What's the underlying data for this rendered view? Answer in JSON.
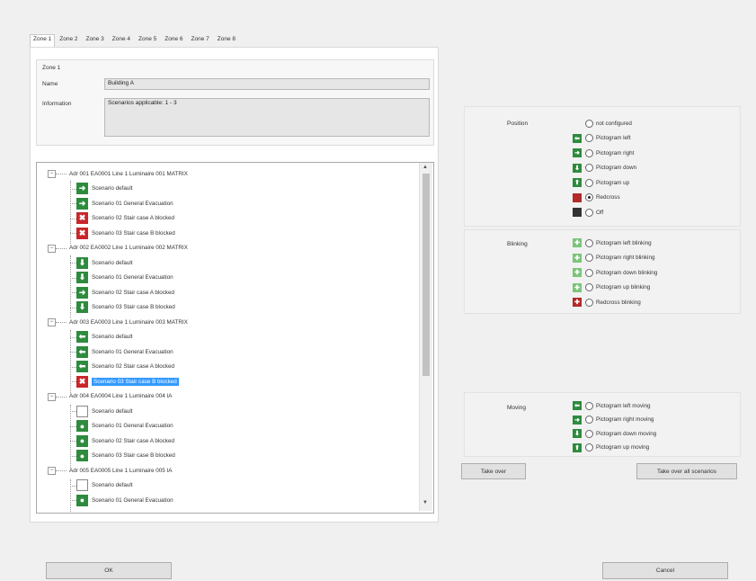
{
  "tabs": [
    "Zone 1",
    "Zone 2",
    "Zone 3",
    "Zone 4",
    "Zone 5",
    "Zone 6",
    "Zone 7",
    "Zone 8"
  ],
  "zone": {
    "title": "Zone 1",
    "name_label": "Name",
    "name_value": "Building A",
    "info_label": "Information",
    "info_value": "Scenarios applicable: 1 - 3"
  },
  "tree": [
    {
      "type": "adr",
      "text": "Adr  001  EA0001  Line 1 Luminaire 001  MATRIX"
    },
    {
      "type": "scn",
      "icon": "g",
      "glyph": "➜",
      "text": "Scenario default"
    },
    {
      "type": "scn",
      "icon": "g",
      "glyph": "➜",
      "text": "Scenario 01   General Evacuation"
    },
    {
      "type": "scn",
      "icon": "r",
      "glyph": "✖",
      "text": "Scenario 02   Stair case A blocked"
    },
    {
      "type": "scn",
      "icon": "r",
      "glyph": "✖",
      "text": "Scenario 03   Stair case B blocked"
    },
    {
      "type": "adr",
      "text": "Adr  002  EA0002  Line 1 Luminaire 002  MATRIX"
    },
    {
      "type": "scn",
      "icon": "g",
      "glyph": "⬇",
      "text": "Scenario default"
    },
    {
      "type": "scn",
      "icon": "g",
      "glyph": "⬇",
      "text": "Scenario 01   General Evacuation"
    },
    {
      "type": "scn",
      "icon": "g",
      "glyph": "➜",
      "text": "Scenario 02   Stair case A blocked"
    },
    {
      "type": "scn",
      "icon": "g",
      "glyph": "⬇",
      "text": "Scenario 03   Stair case B blocked"
    },
    {
      "type": "adr",
      "text": "Adr  003  EA0003  Line 1 Luminaire 003  MATRIX"
    },
    {
      "type": "scn",
      "icon": "g",
      "glyph": "⬅",
      "text": "Scenario default"
    },
    {
      "type": "scn",
      "icon": "g",
      "glyph": "⬅",
      "text": "Scenario 01   General Evacuation"
    },
    {
      "type": "scn",
      "icon": "g",
      "glyph": "⬅",
      "text": "Scenario 02   Stair case A blocked"
    },
    {
      "type": "scn",
      "icon": "r",
      "glyph": "✖",
      "text": "Scenario 03   Stair case B blocked",
      "selected": true
    },
    {
      "type": "adr",
      "text": "Adr  004  EA0004  Line 1 Luminaire 004  IA"
    },
    {
      "type": "scn",
      "icon": "w",
      "glyph": "",
      "text": "Scenario default"
    },
    {
      "type": "scn",
      "icon": "g",
      "glyph": "●",
      "text": "Scenario 01   General Evacuation"
    },
    {
      "type": "scn",
      "icon": "g",
      "glyph": "●",
      "text": "Scenario 02   Stair case A blocked"
    },
    {
      "type": "scn",
      "icon": "g",
      "glyph": "●",
      "text": "Scenario 03   Stair case B blocked"
    },
    {
      "type": "adr",
      "text": "Adr  005  EA0005  Line 1 Luminaire 005  IA"
    },
    {
      "type": "scn",
      "icon": "w",
      "glyph": "",
      "text": "Scenario default"
    },
    {
      "type": "scn",
      "icon": "g",
      "glyph": "●",
      "text": "Scenario 01   General Evacuation"
    }
  ],
  "position": {
    "label": "Position",
    "options": [
      {
        "text": "not configured",
        "swatch": "none",
        "glyph": "",
        "checked": false
      },
      {
        "text": "Pictogram left",
        "swatch": "#2e8b3e",
        "glyph": "⬅",
        "checked": false
      },
      {
        "text": "Pictogram right",
        "swatch": "#2e8b3e",
        "glyph": "➜",
        "checked": false
      },
      {
        "text": "Pictogram down",
        "swatch": "#2e8b3e",
        "glyph": "⬇",
        "checked": false
      },
      {
        "text": "Pictogram up",
        "swatch": "#2e8b3e",
        "glyph": "⬆",
        "checked": false
      },
      {
        "text": "Redcross",
        "swatch": "#b22a2a",
        "glyph": "",
        "checked": true
      },
      {
        "text": "Off",
        "swatch": "#333333",
        "glyph": "",
        "checked": false
      }
    ]
  },
  "blinking": {
    "label": "Blinking",
    "options": [
      {
        "text": "Pictogram left blinking",
        "swatch": "#7cc47c",
        "glyph": "✚",
        "checked": false
      },
      {
        "text": "Pictogram right blinking",
        "swatch": "#7cc47c",
        "glyph": "✚",
        "checked": false
      },
      {
        "text": "Pictogram down blinking",
        "swatch": "#7cc47c",
        "glyph": "✚",
        "checked": false
      },
      {
        "text": "Pictogram up blinking",
        "swatch": "#7cc47c",
        "glyph": "✚",
        "checked": false
      },
      {
        "text": "Redcross blinking",
        "swatch": "#b22a2a",
        "glyph": "✚",
        "checked": false
      }
    ]
  },
  "moving": {
    "label": "Moving",
    "options": [
      {
        "text": "Pictogram left moving",
        "swatch": "#2e8b3e",
        "glyph": "⬅",
        "checked": false
      },
      {
        "text": "Pictogram right moving",
        "swatch": "#2e8b3e",
        "glyph": "➜",
        "checked": false
      },
      {
        "text": "Pictogram down moving",
        "swatch": "#2e8b3e",
        "glyph": "⬇",
        "checked": false
      },
      {
        "text": "Pictogram up moving",
        "swatch": "#2e8b3e",
        "glyph": "⬆",
        "checked": false
      }
    ]
  },
  "buttons": {
    "take_over": "Take over",
    "take_over_all": "Take over all scenarios",
    "ok": "OK",
    "cancel": "Cancel"
  }
}
